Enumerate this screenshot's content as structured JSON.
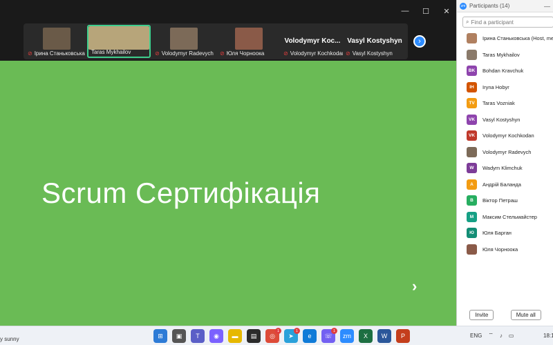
{
  "window": {
    "minimize": "—",
    "maximize": "☐",
    "close": "✕"
  },
  "gallery": {
    "tiles": [
      {
        "name": "Ірина Станьковська",
        "muted": true,
        "thumb_color": "#6a5a48"
      },
      {
        "name": "Taras Mykhailov",
        "muted": false,
        "thumb_color": "#b7a57a"
      },
      {
        "name": "Volodymyr Radevych",
        "muted": true,
        "thumb_color": "#7c6a58"
      },
      {
        "name": "Юля Чорноока",
        "muted": true,
        "thumb_color": "#8a5a48"
      },
      {
        "name": "Volodymyr Kochkodan",
        "display": "Volodymyr  Koc...",
        "muted": true
      },
      {
        "name": "Vasyl Kostyshyn",
        "display": "Vasyl Kostyshyn",
        "muted": true
      }
    ],
    "next_icon": "›"
  },
  "slide": {
    "title": "Scrum Сертифікація",
    "next_icon": "›",
    "bg": "#6abb55"
  },
  "panel": {
    "title": "Participants (14)",
    "logo": "zm",
    "search_placeholder": "Find a participant",
    "participants": [
      {
        "name": "Ірина Станьковська (Host, me)",
        "initials": "",
        "color": "#b08060",
        "photo": true
      },
      {
        "name": "Taras Mykhailov",
        "initials": "",
        "color": "#8a7a6a",
        "photo": true
      },
      {
        "name": "Bohdan Kravchuk",
        "initials": "BK",
        "color": "#8e44ad"
      },
      {
        "name": "Iryna Hobyr",
        "initials": "IH",
        "color": "#d35400"
      },
      {
        "name": "Taras Vozniak",
        "initials": "TV",
        "color": "#f39c12"
      },
      {
        "name": "Vasyl Kostyshyn",
        "initials": "VK",
        "color": "#8e44ad"
      },
      {
        "name": "Volodymyr Kochkodan",
        "initials": "VK",
        "color": "#c0392b"
      },
      {
        "name": "Volodymyr Radevych",
        "initials": "",
        "color": "#7c6a58",
        "photo": true
      },
      {
        "name": "Wadym Klimchuk",
        "initials": "W",
        "color": "#7d3c98"
      },
      {
        "name": "Андрій Баланда",
        "initials": "А",
        "color": "#f39c12"
      },
      {
        "name": "Віктор Петраш",
        "initials": "В",
        "color": "#27ae60"
      },
      {
        "name": "Максим Стельмайстер",
        "initials": "М",
        "color": "#16a085"
      },
      {
        "name": "Юля Барган",
        "initials": "Ю",
        "color": "#138d75"
      },
      {
        "name": "Юля Чорноока",
        "initials": "",
        "color": "#8a5a48",
        "photo": true
      }
    ],
    "invite_label": "Invite",
    "mute_all_label": "Mute all"
  },
  "taskbar": {
    "weather": "y sunny",
    "apps": [
      {
        "name": "windows-start",
        "color": "#2d7bd6",
        "glyph": "⊞"
      },
      {
        "name": "task-view",
        "color": "#555555",
        "glyph": "▣"
      },
      {
        "name": "teams",
        "color": "#5b5fc7",
        "glyph": "T"
      },
      {
        "name": "copilot",
        "color": "#7b61ff",
        "glyph": "◉"
      },
      {
        "name": "explorer",
        "color": "#e6b800",
        "glyph": "▬"
      },
      {
        "name": "store",
        "color": "#2b2b2b",
        "glyph": "▤"
      },
      {
        "name": "chrome",
        "color": "#dd4b39",
        "glyph": "◎",
        "badge": "1"
      },
      {
        "name": "telegram",
        "color": "#2aa1da",
        "glyph": "➤",
        "badge": "1"
      },
      {
        "name": "edge",
        "color": "#0f7bd8",
        "glyph": "e"
      },
      {
        "name": "viber",
        "color": "#7360f2",
        "glyph": "☏",
        "badge": "1"
      },
      {
        "name": "zoom",
        "color": "#2d8cff",
        "glyph": "zm"
      },
      {
        "name": "excel",
        "color": "#1d6f42",
        "glyph": "X"
      },
      {
        "name": "word",
        "color": "#2b579a",
        "glyph": "W"
      },
      {
        "name": "powerpoint",
        "color": "#c43e1c",
        "glyph": "P"
      }
    ],
    "lang": "ENG",
    "clock": "18:1"
  }
}
